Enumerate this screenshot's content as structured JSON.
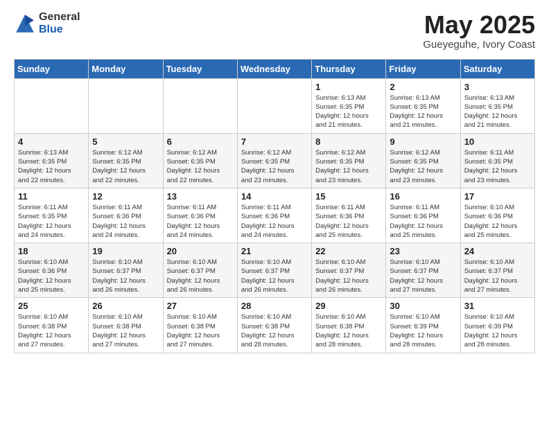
{
  "header": {
    "logo_general": "General",
    "logo_blue": "Blue",
    "month": "May 2025",
    "location": "Gueyeguhe, Ivory Coast"
  },
  "weekdays": [
    "Sunday",
    "Monday",
    "Tuesday",
    "Wednesday",
    "Thursday",
    "Friday",
    "Saturday"
  ],
  "weeks": [
    [
      {
        "day": "",
        "info": ""
      },
      {
        "day": "",
        "info": ""
      },
      {
        "day": "",
        "info": ""
      },
      {
        "day": "",
        "info": ""
      },
      {
        "day": "1",
        "info": "Sunrise: 6:13 AM\nSunset: 6:35 PM\nDaylight: 12 hours\nand 21 minutes."
      },
      {
        "day": "2",
        "info": "Sunrise: 6:13 AM\nSunset: 6:35 PM\nDaylight: 12 hours\nand 21 minutes."
      },
      {
        "day": "3",
        "info": "Sunrise: 6:13 AM\nSunset: 6:35 PM\nDaylight: 12 hours\nand 21 minutes."
      }
    ],
    [
      {
        "day": "4",
        "info": "Sunrise: 6:13 AM\nSunset: 6:35 PM\nDaylight: 12 hours\nand 22 minutes."
      },
      {
        "day": "5",
        "info": "Sunrise: 6:12 AM\nSunset: 6:35 PM\nDaylight: 12 hours\nand 22 minutes."
      },
      {
        "day": "6",
        "info": "Sunrise: 6:12 AM\nSunset: 6:35 PM\nDaylight: 12 hours\nand 22 minutes."
      },
      {
        "day": "7",
        "info": "Sunrise: 6:12 AM\nSunset: 6:35 PM\nDaylight: 12 hours\nand 23 minutes."
      },
      {
        "day": "8",
        "info": "Sunrise: 6:12 AM\nSunset: 6:35 PM\nDaylight: 12 hours\nand 23 minutes."
      },
      {
        "day": "9",
        "info": "Sunrise: 6:12 AM\nSunset: 6:35 PM\nDaylight: 12 hours\nand 23 minutes."
      },
      {
        "day": "10",
        "info": "Sunrise: 6:11 AM\nSunset: 6:35 PM\nDaylight: 12 hours\nand 23 minutes."
      }
    ],
    [
      {
        "day": "11",
        "info": "Sunrise: 6:11 AM\nSunset: 6:35 PM\nDaylight: 12 hours\nand 24 minutes."
      },
      {
        "day": "12",
        "info": "Sunrise: 6:11 AM\nSunset: 6:36 PM\nDaylight: 12 hours\nand 24 minutes."
      },
      {
        "day": "13",
        "info": "Sunrise: 6:11 AM\nSunset: 6:36 PM\nDaylight: 12 hours\nand 24 minutes."
      },
      {
        "day": "14",
        "info": "Sunrise: 6:11 AM\nSunset: 6:36 PM\nDaylight: 12 hours\nand 24 minutes."
      },
      {
        "day": "15",
        "info": "Sunrise: 6:11 AM\nSunset: 6:36 PM\nDaylight: 12 hours\nand 25 minutes."
      },
      {
        "day": "16",
        "info": "Sunrise: 6:11 AM\nSunset: 6:36 PM\nDaylight: 12 hours\nand 25 minutes."
      },
      {
        "day": "17",
        "info": "Sunrise: 6:10 AM\nSunset: 6:36 PM\nDaylight: 12 hours\nand 25 minutes."
      }
    ],
    [
      {
        "day": "18",
        "info": "Sunrise: 6:10 AM\nSunset: 6:36 PM\nDaylight: 12 hours\nand 25 minutes."
      },
      {
        "day": "19",
        "info": "Sunrise: 6:10 AM\nSunset: 6:37 PM\nDaylight: 12 hours\nand 26 minutes."
      },
      {
        "day": "20",
        "info": "Sunrise: 6:10 AM\nSunset: 6:37 PM\nDaylight: 12 hours\nand 26 minutes."
      },
      {
        "day": "21",
        "info": "Sunrise: 6:10 AM\nSunset: 6:37 PM\nDaylight: 12 hours\nand 26 minutes."
      },
      {
        "day": "22",
        "info": "Sunrise: 6:10 AM\nSunset: 6:37 PM\nDaylight: 12 hours\nand 26 minutes."
      },
      {
        "day": "23",
        "info": "Sunrise: 6:10 AM\nSunset: 6:37 PM\nDaylight: 12 hours\nand 27 minutes."
      },
      {
        "day": "24",
        "info": "Sunrise: 6:10 AM\nSunset: 6:37 PM\nDaylight: 12 hours\nand 27 minutes."
      }
    ],
    [
      {
        "day": "25",
        "info": "Sunrise: 6:10 AM\nSunset: 6:38 PM\nDaylight: 12 hours\nand 27 minutes."
      },
      {
        "day": "26",
        "info": "Sunrise: 6:10 AM\nSunset: 6:38 PM\nDaylight: 12 hours\nand 27 minutes."
      },
      {
        "day": "27",
        "info": "Sunrise: 6:10 AM\nSunset: 6:38 PM\nDaylight: 12 hours\nand 27 minutes."
      },
      {
        "day": "28",
        "info": "Sunrise: 6:10 AM\nSunset: 6:38 PM\nDaylight: 12 hours\nand 28 minutes."
      },
      {
        "day": "29",
        "info": "Sunrise: 6:10 AM\nSunset: 6:38 PM\nDaylight: 12 hours\nand 28 minutes."
      },
      {
        "day": "30",
        "info": "Sunrise: 6:10 AM\nSunset: 6:39 PM\nDaylight: 12 hours\nand 28 minutes."
      },
      {
        "day": "31",
        "info": "Sunrise: 6:10 AM\nSunset: 6:39 PM\nDaylight: 12 hours\nand 28 minutes."
      }
    ]
  ]
}
